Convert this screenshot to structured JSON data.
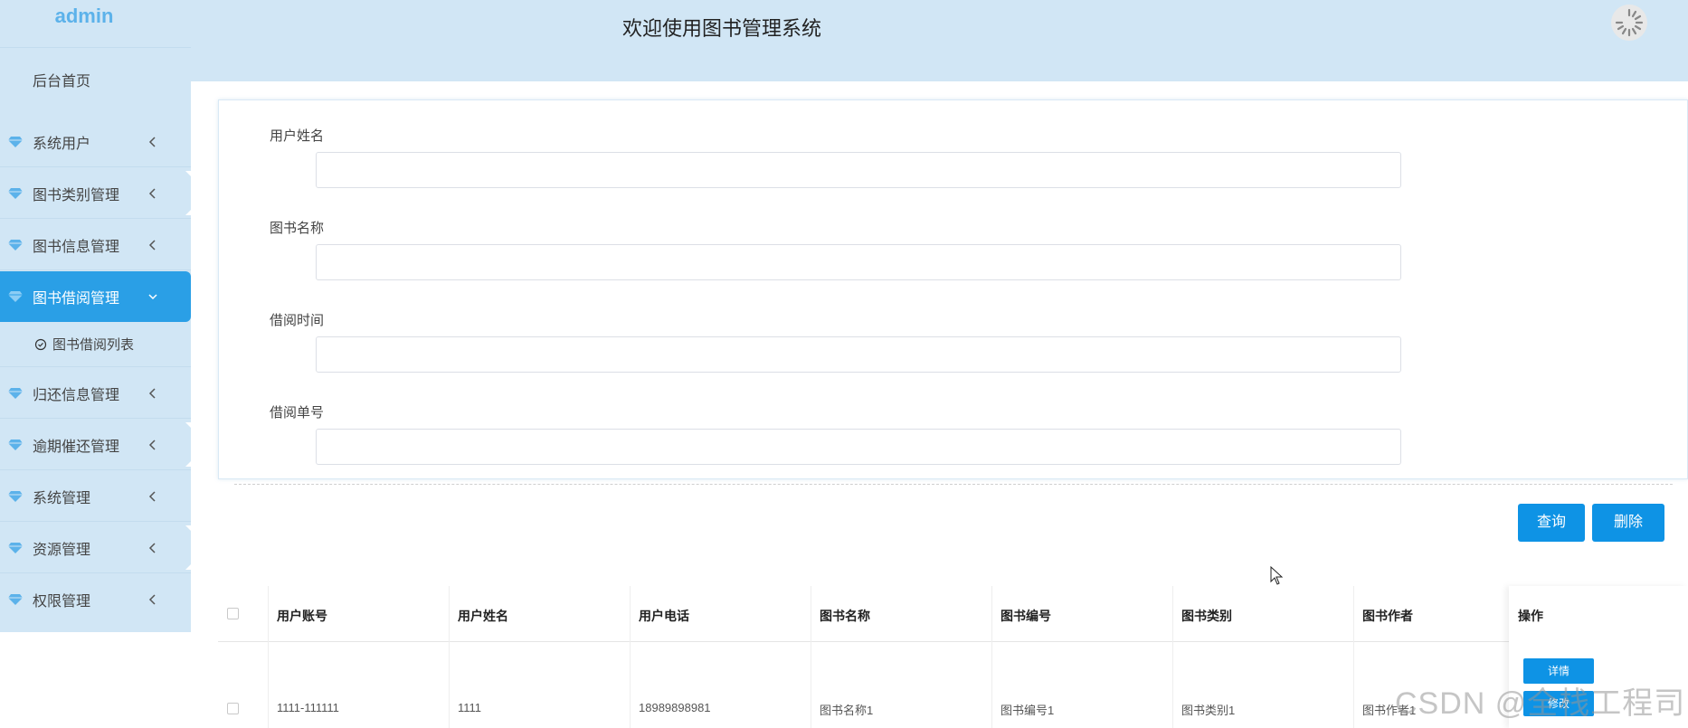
{
  "brand": "admin",
  "header": {
    "title": "欢迎使用图书管理系统"
  },
  "sidebar": {
    "home": "后台首页",
    "items": [
      {
        "label": "系统用户"
      },
      {
        "label": "图书类别管理"
      },
      {
        "label": "图书信息管理"
      },
      {
        "label": "图书借阅管理"
      },
      {
        "label": "归还信息管理"
      },
      {
        "label": "逾期催还管理"
      },
      {
        "label": "系统管理"
      },
      {
        "label": "资源管理"
      },
      {
        "label": "权限管理"
      }
    ],
    "submenu": {
      "label": "图书借阅列表"
    }
  },
  "search": {
    "fields": [
      {
        "label": "用户姓名",
        "value": ""
      },
      {
        "label": "图书名称",
        "value": ""
      },
      {
        "label": "借阅时间",
        "value": ""
      },
      {
        "label": "借阅单号",
        "value": ""
      }
    ],
    "query_label": "查询",
    "delete_label": "删除"
  },
  "table": {
    "headers": [
      "用户账号",
      "用户姓名",
      "用户电话",
      "图书名称",
      "图书编号",
      "图书类别",
      "图书作者",
      "操作"
    ],
    "rows": [
      {
        "cells": [
          "1111-111111",
          "1111",
          "18989898981",
          "图书名称1",
          "图书编号1",
          "图书类别1",
          "图书作者1"
        ],
        "detail_label": "详情",
        "edit_label": "修改"
      }
    ]
  },
  "watermark": "CSDN @全栈工程司",
  "colors": {
    "accent": "#0e93e5",
    "sidebar_bg": "#d1e6f5",
    "active_item": "#2a9fe6",
    "brand": "#5cb2ea"
  },
  "icons": {
    "menu": "gem-icon",
    "expand": "chevron-left-icon",
    "expanded": "chevron-down-icon",
    "submenu": "check-circle-icon"
  }
}
